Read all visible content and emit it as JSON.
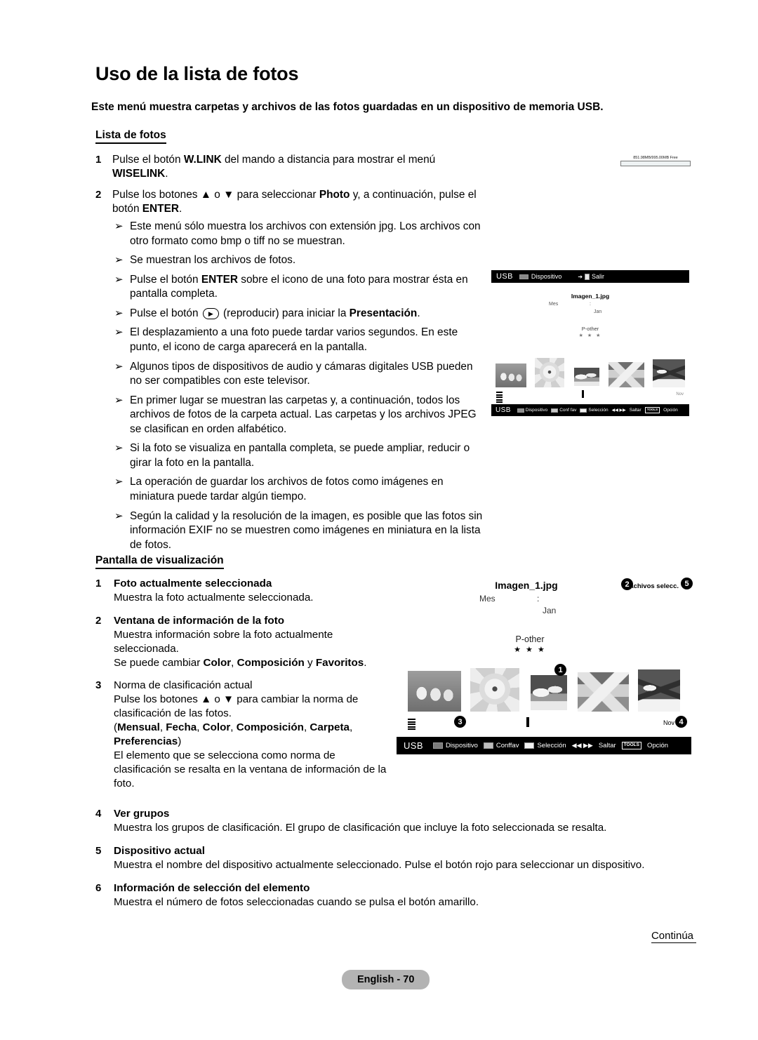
{
  "doc": {
    "title": "Uso de la lista de fotos",
    "intro": "Este menú muestra carpetas y archivos de las fotos guardadas en un dispositivo de memoria USB.",
    "section1_head": "Lista de fotos",
    "section2_head": "Pantalla de visualización",
    "continua": "Continúa",
    "page_badge": "English - 70"
  },
  "steps": [
    {
      "num": "1",
      "html": "Pulse el botón <b>W.LINK</b> del mando a distancia para mostrar el menú <b>WISELINK</b>."
    },
    {
      "num": "2",
      "html": "Pulse los botones ▲ o ▼ para seleccionar <b>Photo</b> y, a continuación, pulse el botón <b>ENTER</b>."
    }
  ],
  "bullets": [
    {
      "mark": "➢",
      "html": "Este menú sólo muestra los archivos con extensión jpg. Los archivos con otro formato como bmp o tiff no se muestran."
    },
    {
      "mark": "➢",
      "html": "Se muestran los archivos de fotos."
    },
    {
      "mark": "➢",
      "html": "Pulse el botón <b>ENTER</b> sobre el icono de una foto para mostrar ésta en pantalla completa."
    },
    {
      "mark": "➢",
      "html": "Pulse el botón <span class=\"play-btn\">▶</span> (reproducir) para iniciar la <b>Presentación</b>."
    },
    {
      "mark": "➢",
      "html": "El desplazamiento a una foto puede tardar varios segundos. En este punto, el icono de carga aparecerá en la pantalla."
    },
    {
      "mark": "➢",
      "html": "Algunos tipos de dispositivos de audio y cámaras digitales USB pueden no ser compatibles con este televisor."
    },
    {
      "mark": "➢",
      "html": "En primer lugar se muestran las carpetas y, a continuación, todos los archivos de fotos de la carpeta actual. Las carpetas y los archivos JPEG se clasifican en orden alfabético."
    },
    {
      "mark": "➢",
      "html": "Si la foto se visualiza en pantalla completa, se puede ampliar, reducir o girar la foto en la pantalla."
    },
    {
      "mark": "➢",
      "html": "La operación de guardar los archivos de fotos como imágenes en miniatura puede tardar algún tiempo."
    },
    {
      "mark": "➢",
      "html": "Según la calidad y la resolución de la imagen, es posible que las fotos sin información EXIF no se muestren como imágenes en miniatura en la lista de fotos."
    }
  ],
  "display_items_left": [
    {
      "num": "1",
      "title": "Foto actualmente seleccionada",
      "html": "Muestra la foto actualmente seleccionada."
    },
    {
      "num": "2",
      "title": "Ventana de información de la foto",
      "html": "Muestra información sobre la foto actualmente seleccionada.<br>Se puede cambiar <b>Color</b>, <b>Composición</b> y <b>Favoritos</b>."
    },
    {
      "num": "3",
      "title": "Norma de clasificación actual",
      "title_bold": false,
      "html": "Pulse los botones ▲ o ▼ para cambiar la norma de clasificación de las fotos.<br>(<b>Mensual</b>, <b>Fecha</b>, <b>Color</b>, <b>Composición</b>, <b>Carpeta</b>, <b>Preferencias</b>)<br>El elemento que se selecciona como norma de clasificación se resalta en la ventana de información de la foto."
    }
  ],
  "display_items_bottom": [
    {
      "num": "4",
      "title": "Ver grupos",
      "html": "Muestra los grupos de clasificación. El grupo de clasificación que incluye la foto seleccionada se resalta."
    },
    {
      "num": "5",
      "title": "Dispositivo actual",
      "html": "Muestra el nombre del dispositivo actualmente seleccionado. Pulse el botón rojo para seleccionar un dispositivo."
    },
    {
      "num": "6",
      "title": "Información de selección del elemento",
      "html": "Muestra el número de fotos seleccionadas cuando se pulsa el botón amarillo."
    }
  ],
  "memory_bar": {
    "label": "851.98MB/995.00MB Free"
  },
  "tv_screen_1": {
    "top_bar": {
      "usb": "USB",
      "device_label": "Dispositivo",
      "exit_label": "Salir"
    },
    "file_name": "Imagen_1.jpg",
    "sort_label": "Mes",
    "sort_colon": ":",
    "month": "Jan",
    "composition": "P-other",
    "stars": "★ ★ ★",
    "group_right": "Nov",
    "bottom_bar": {
      "usb": "USB",
      "device": "Dispositivo",
      "conffav": "Conf fav",
      "selection": "Selección",
      "skip_arrows": "◀◀ ▶▶",
      "skip": "Saltar",
      "tools": "TOOLS",
      "option": "Opción"
    }
  },
  "tv_screen_2": {
    "file_name": "Imagen_1.jpg",
    "sort_label": "Mes",
    "sort_colon": ":",
    "month": "Jan",
    "composition": "P-other",
    "stars": "★ ★ ★",
    "selected_count": "1achivos selecc.",
    "group_right": "Nov",
    "callouts": [
      "1",
      "2",
      "3",
      "4",
      "5"
    ],
    "bottom_bar": {
      "usb": "USB",
      "device": "Dispositivo",
      "conffav": "Conffav",
      "selection": "Selección",
      "skip_arrows": "◀◀ ▶▶",
      "skip": "Saltar",
      "tools": "TOOLS",
      "option": "Opción"
    }
  }
}
